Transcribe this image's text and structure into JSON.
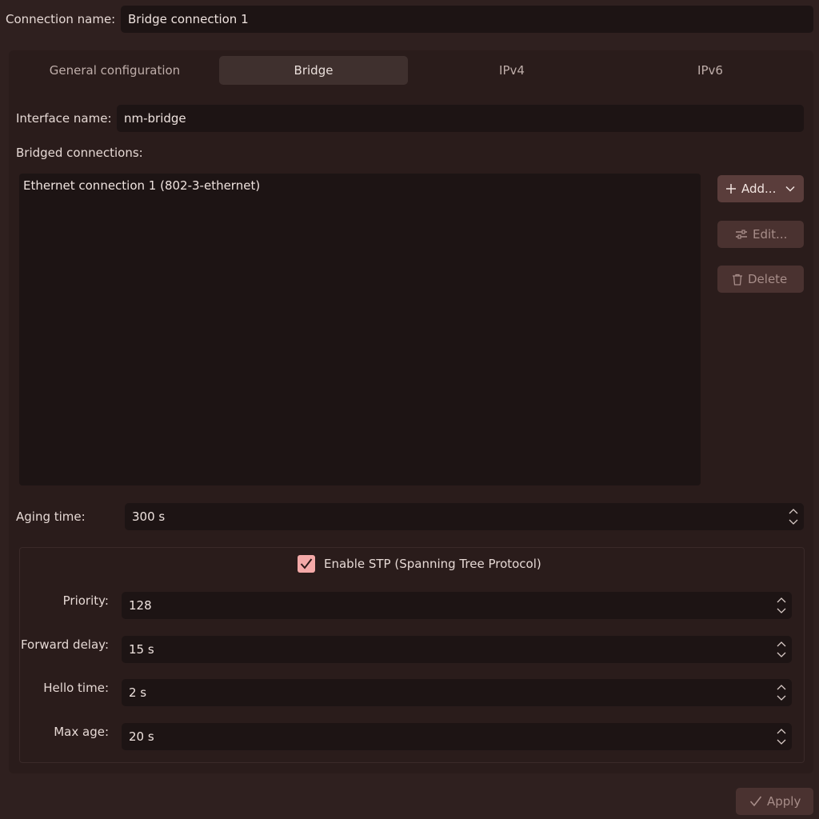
{
  "connection": {
    "label": "Connection name:",
    "value": "Bridge connection 1"
  },
  "tabs": [
    {
      "label": "General configuration",
      "active": false
    },
    {
      "label": "Bridge",
      "active": true
    },
    {
      "label": "IPv4",
      "active": false
    },
    {
      "label": "IPv6",
      "active": false
    }
  ],
  "bridge": {
    "interface_label": "Interface name:",
    "interface_value": "nm-bridge",
    "bridged_label": "Bridged connections:",
    "connections": [
      "Ethernet connection 1 (802-3-ethernet)"
    ],
    "add_label": "Add...",
    "edit_label": "Edit...",
    "delete_label": "Delete",
    "aging_label": "Aging time:",
    "aging_value": "300 s"
  },
  "stp": {
    "checkbox_label": "Enable STP (Spanning Tree Protocol)",
    "checked": true,
    "priority_label": "Priority:",
    "priority_value": "128",
    "forward_label": "Forward delay:",
    "forward_value": "15 s",
    "hello_label": "Hello time:",
    "hello_value": "2 s",
    "maxage_label": "Max age:",
    "maxage_value": "20 s"
  },
  "footer": {
    "apply_label": "Apply"
  },
  "colors": {
    "accent": "#f4a9a8",
    "background": "#2f201f",
    "field": "#1d1414"
  }
}
